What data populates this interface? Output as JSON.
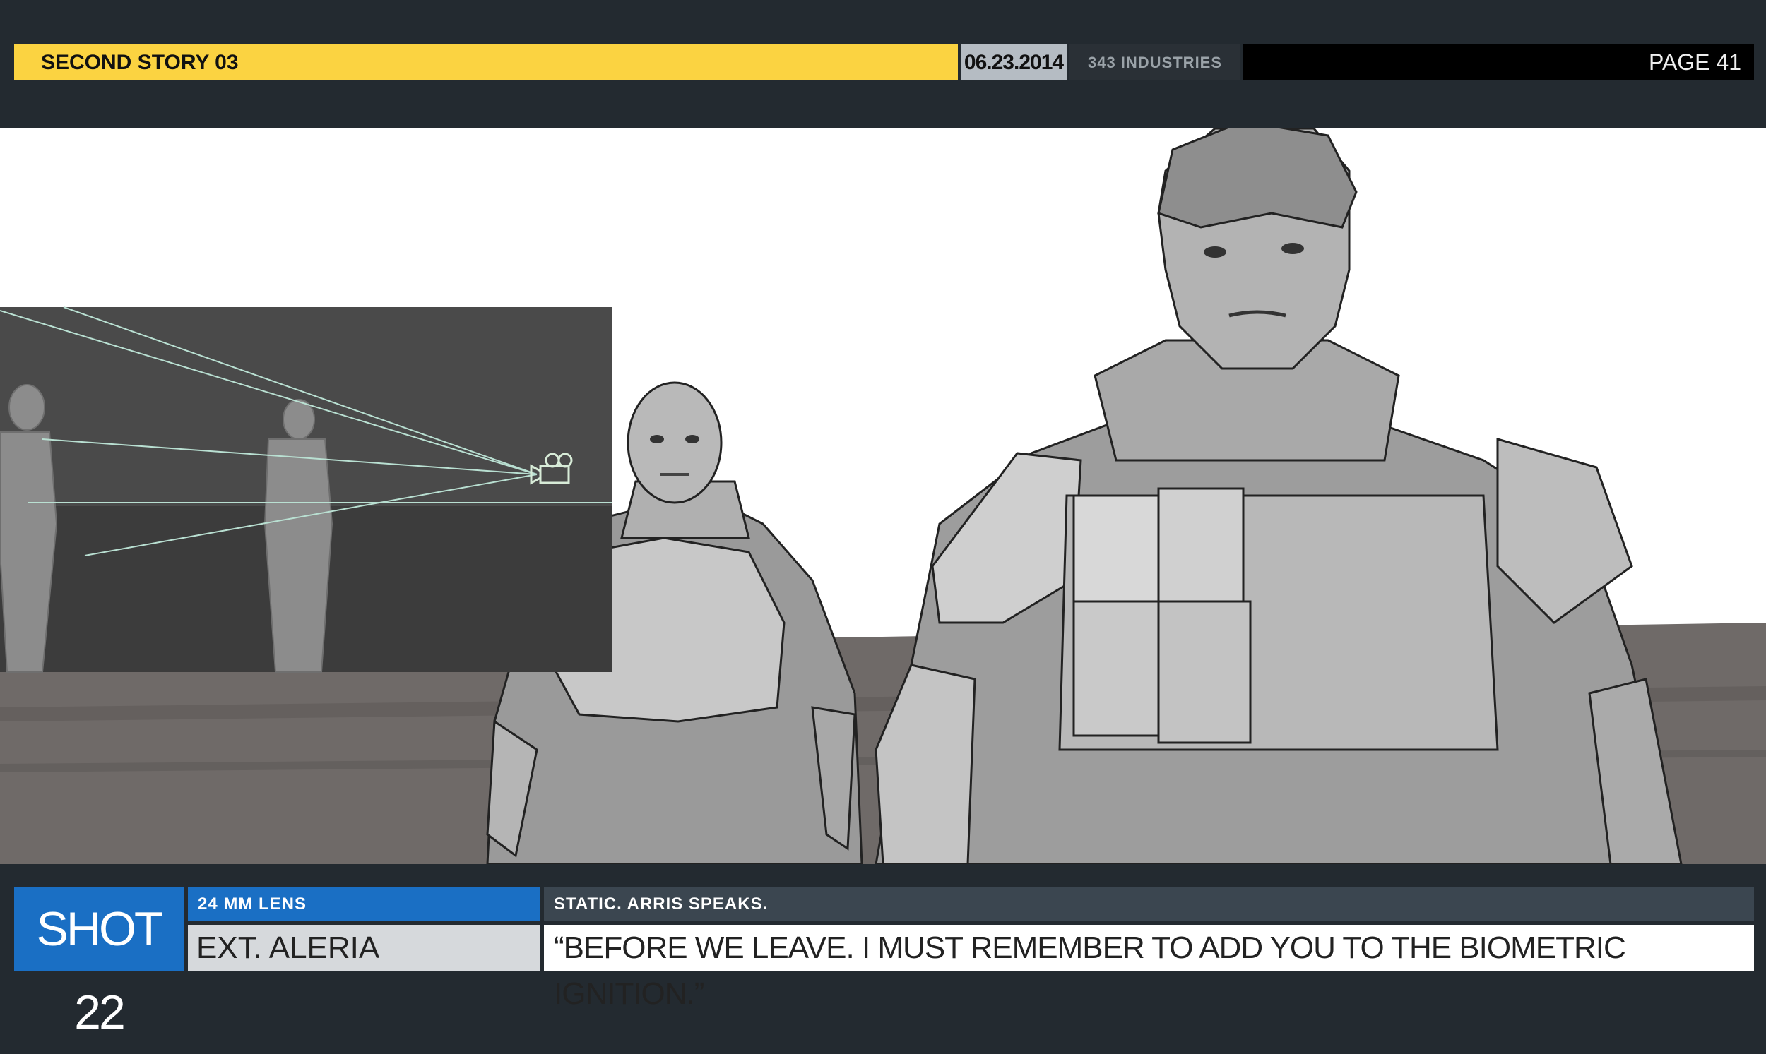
{
  "header": {
    "title": "SECOND STORY 03",
    "date": "06.23.2014",
    "brand": "343 INDUSTRIES",
    "page": "PAGE 41"
  },
  "shot": {
    "label": "SHOT 22",
    "lens": "24 MM LENS",
    "location": "EXT.  ALERIA",
    "action": "STATIC.  ARRIS SPEAKS.",
    "dialogue": "“BEFORE WE LEAVE.  I MUST REMEMBER TO ADD YOU TO THE BIOMETRIC IGNITION.”"
  },
  "colors": {
    "background": "#232a30",
    "header_yellow": "#fbd341",
    "shot_blue": "#1a6fc4",
    "action_bar": "#3b4650"
  },
  "icons": [
    "camera-icon"
  ]
}
